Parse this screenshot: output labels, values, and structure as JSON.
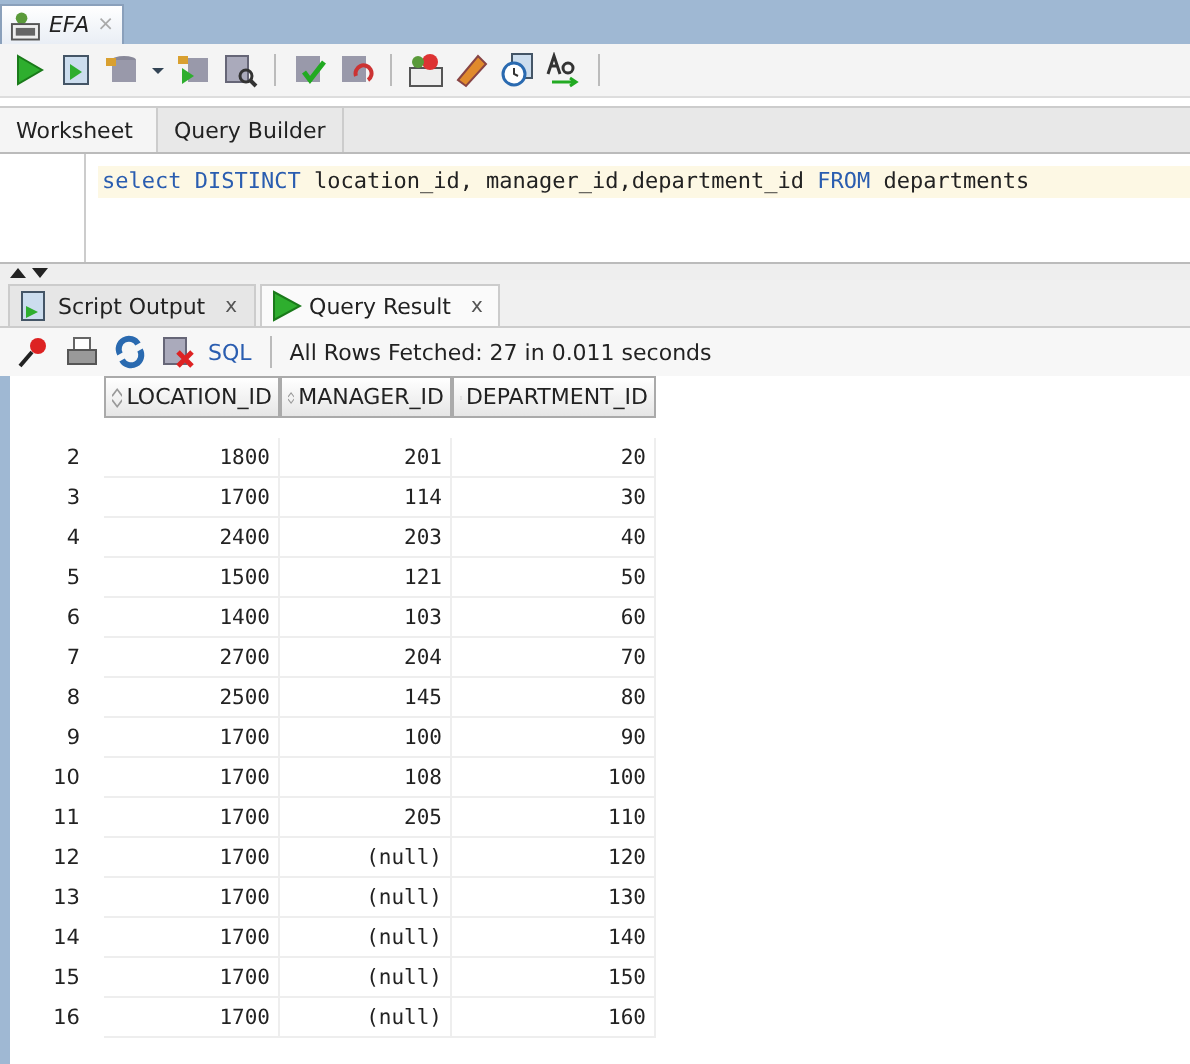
{
  "document_tab": {
    "title": "EFA",
    "close": "×"
  },
  "editor_tabs": [
    {
      "label": "Worksheet",
      "selected": true
    },
    {
      "label": "Query Builder",
      "selected": false
    }
  ],
  "editor": {
    "code": [
      {
        "kind": "keyword",
        "text": "select DISTINCT"
      },
      {
        "kind": "plain",
        "text": " location_id, manager_id,department_id "
      },
      {
        "kind": "keyword",
        "text": "FROM"
      },
      {
        "kind": "plain",
        "text": " departments"
      }
    ]
  },
  "result_tabs": [
    {
      "label": "Script Output",
      "close": "x",
      "selected": false
    },
    {
      "label": "Query Result",
      "close": "x",
      "selected": true
    }
  ],
  "result_toolbar": {
    "sql_link": "SQL",
    "status": "All Rows Fetched: 27 in 0.011 seconds"
  },
  "table": {
    "columns": [
      "LOCATION_ID",
      "MANAGER_ID",
      "DEPARTMENT_ID"
    ],
    "rows": [
      {
        "number": "2",
        "cells": [
          "1800",
          "201",
          "20"
        ]
      },
      {
        "number": "3",
        "cells": [
          "1700",
          "114",
          "30"
        ]
      },
      {
        "number": "4",
        "cells": [
          "2400",
          "203",
          "40"
        ]
      },
      {
        "number": "5",
        "cells": [
          "1500",
          "121",
          "50"
        ]
      },
      {
        "number": "6",
        "cells": [
          "1400",
          "103",
          "60"
        ]
      },
      {
        "number": "7",
        "cells": [
          "2700",
          "204",
          "70"
        ]
      },
      {
        "number": "8",
        "cells": [
          "2500",
          "145",
          "80"
        ]
      },
      {
        "number": "9",
        "cells": [
          "1700",
          "100",
          "90"
        ]
      },
      {
        "number": "10",
        "cells": [
          "1700",
          "108",
          "100"
        ]
      },
      {
        "number": "11",
        "cells": [
          "1700",
          "205",
          "110"
        ]
      },
      {
        "number": "12",
        "cells": [
          "1700",
          "(null)",
          "120"
        ]
      },
      {
        "number": "13",
        "cells": [
          "1700",
          "(null)",
          "130"
        ]
      },
      {
        "number": "14",
        "cells": [
          "1700",
          "(null)",
          "140"
        ]
      },
      {
        "number": "15",
        "cells": [
          "1700",
          "(null)",
          "150"
        ]
      },
      {
        "number": "16",
        "cells": [
          "1700",
          "(null)",
          "160"
        ]
      }
    ]
  }
}
